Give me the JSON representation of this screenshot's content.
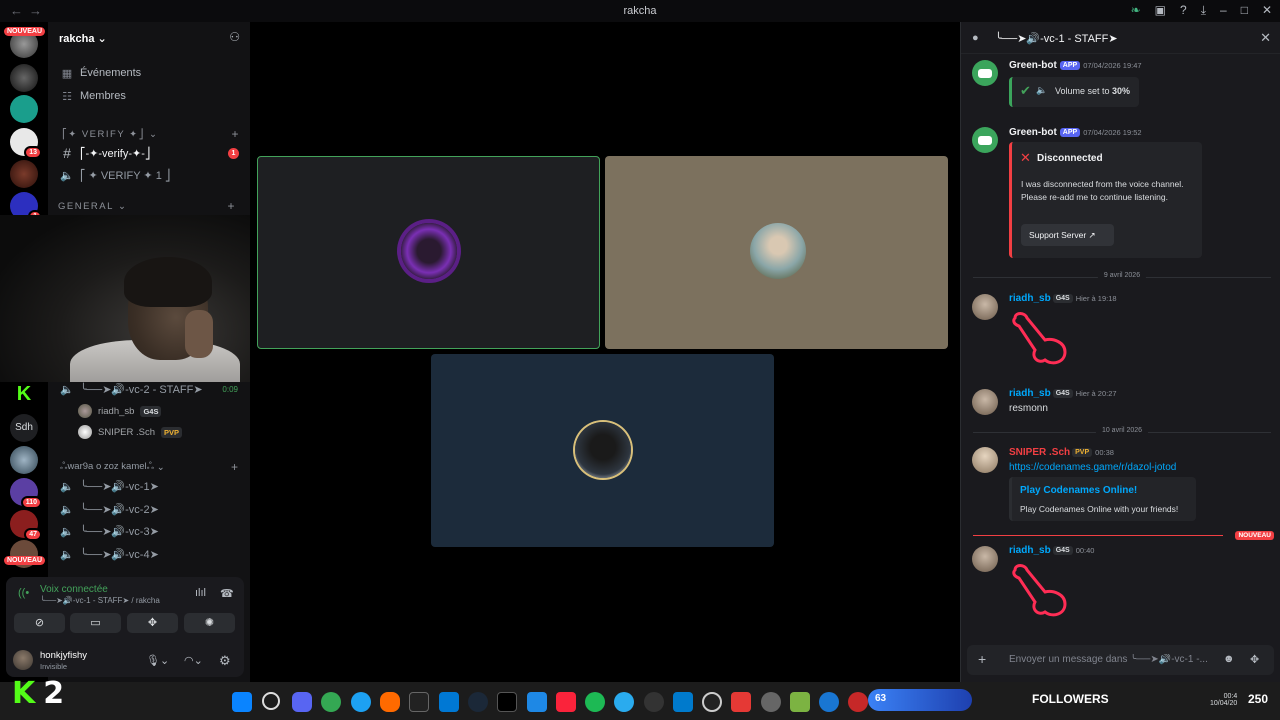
{
  "titlebar": {
    "nav": "←→",
    "title": "rakcha"
  },
  "rail": {
    "top_badge": "NOUVEAU",
    "bottom_badge": "NOUVEAU",
    "counts": [
      "13",
      "1",
      "110",
      "47"
    ],
    "text_server": "Sdh"
  },
  "sidebar": {
    "guild": "rakcha",
    "events": "Événements",
    "members": "Membres",
    "cat_verify": "⎡✦ VERIFY ✦⎦",
    "ch_verify": "⎡-✦-verify-✦-⎦",
    "ch_verify_count": "1",
    "ch_verify_voice": "⎡ ✦ VERIFY ✦ 1 ⎦",
    "cat_general": "GENERAL",
    "vc2": "╰──➤🔊-vc-2 - STAFF➤",
    "vc2_time": "0:09",
    "users": [
      {
        "name": "riadh_sb",
        "tag": "G4S"
      },
      {
        "name": "SNIPER .Sch",
        "tag": "PVP"
      }
    ],
    "cat_war": "ஃwar9a o zoz kamelஃ",
    "vcs": [
      "╰──➤🔊-vc-1➤",
      "╰──➤🔊-vc-2➤",
      "╰──➤🔊-vc-3➤",
      "╰──➤🔊-vc-4➤"
    ]
  },
  "voice": {
    "status": "Voix connectée",
    "channel": "╰──➤🔊-vc-1 - STAFF➤ / rakcha"
  },
  "me": {
    "name": "honkjyfishy",
    "status": "Invisible"
  },
  "chat": {
    "title": "╰──➤🔊-vc-1 - STAFF➤",
    "msg1": {
      "author": "Green-bot",
      "app": "APP",
      "time": "07/04/2026 19:47",
      "text_pre": "Volume set to ",
      "text_bold": "30%"
    },
    "msg2": {
      "author": "Green-bot",
      "app": "APP",
      "time": "07/04/2026 19:52",
      "embed_title": "Disconnected",
      "embed_l1": "I was disconnected from the voice channel.",
      "embed_l2": "Please re-add me to continue listening.",
      "button": "Support Server"
    },
    "date1": "9 avril 2026",
    "msg3": {
      "author": "riadh_sb",
      "tag": "G4S",
      "time": "Hier à 19:18"
    },
    "msg4": {
      "author": "riadh_sb",
      "tag": "G4S",
      "time": "Hier à 20:27",
      "text": "resmonn"
    },
    "date2": "10 avril 2026",
    "msg5": {
      "author": "SNIPER .Sch",
      "tag": "PVP",
      "time": "00:38",
      "link": "https://codenames.game/r/dazol-jotod",
      "embed_title": "Play Codenames Online!",
      "embed_desc": "Play Codenames Online with your friends!"
    },
    "new_label": "NOUVEAU",
    "msg6": {
      "author": "riadh_sb",
      "tag": "G4S",
      "time": "00:40"
    },
    "composer_placeholder": "Envoyer un message dans ╰──➤🔊-vc-1 -..."
  },
  "overlay": {
    "kick_digit": "2",
    "followers_label": "FOLLOWERS",
    "followers_count": "250",
    "pill_count": "63",
    "clock_time": "00:4",
    "clock_date": "10/04/20"
  },
  "colors": {
    "accent": "#5865f2",
    "online": "#43a25a",
    "danger": "#f23f43",
    "link": "#00a8fc",
    "kick": "#53fc18"
  }
}
